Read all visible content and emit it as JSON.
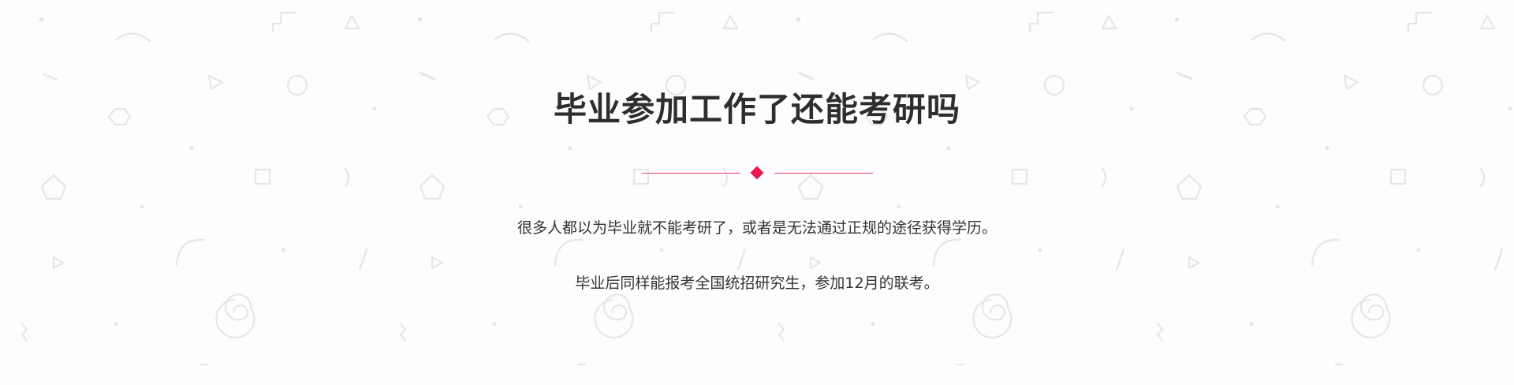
{
  "section": {
    "title": "毕业参加工作了还能考研吗",
    "paragraphs": [
      "很多人都以为毕业就不能考研了，或者是无法通过正规的途径获得学历。",
      "毕业后同样能报考全国统招研究生，参加12月的联考。"
    ]
  },
  "colors": {
    "background": "#fdfdfe",
    "accent": "#e8184a",
    "divider_line": "#ec3f5e",
    "title_text": "#2e2e2e",
    "body_text": "#333333",
    "pattern_shapes": "#e6e8ec"
  },
  "decorations": {
    "divider_icon": "diamond-icon",
    "background_pattern": [
      "dot-icon",
      "zigzag-icon",
      "triangle-icon",
      "arc-icon",
      "dash-icon",
      "circle-icon",
      "hexagon-icon",
      "square-icon",
      "pentagon-icon",
      "spiral-icon"
    ]
  }
}
